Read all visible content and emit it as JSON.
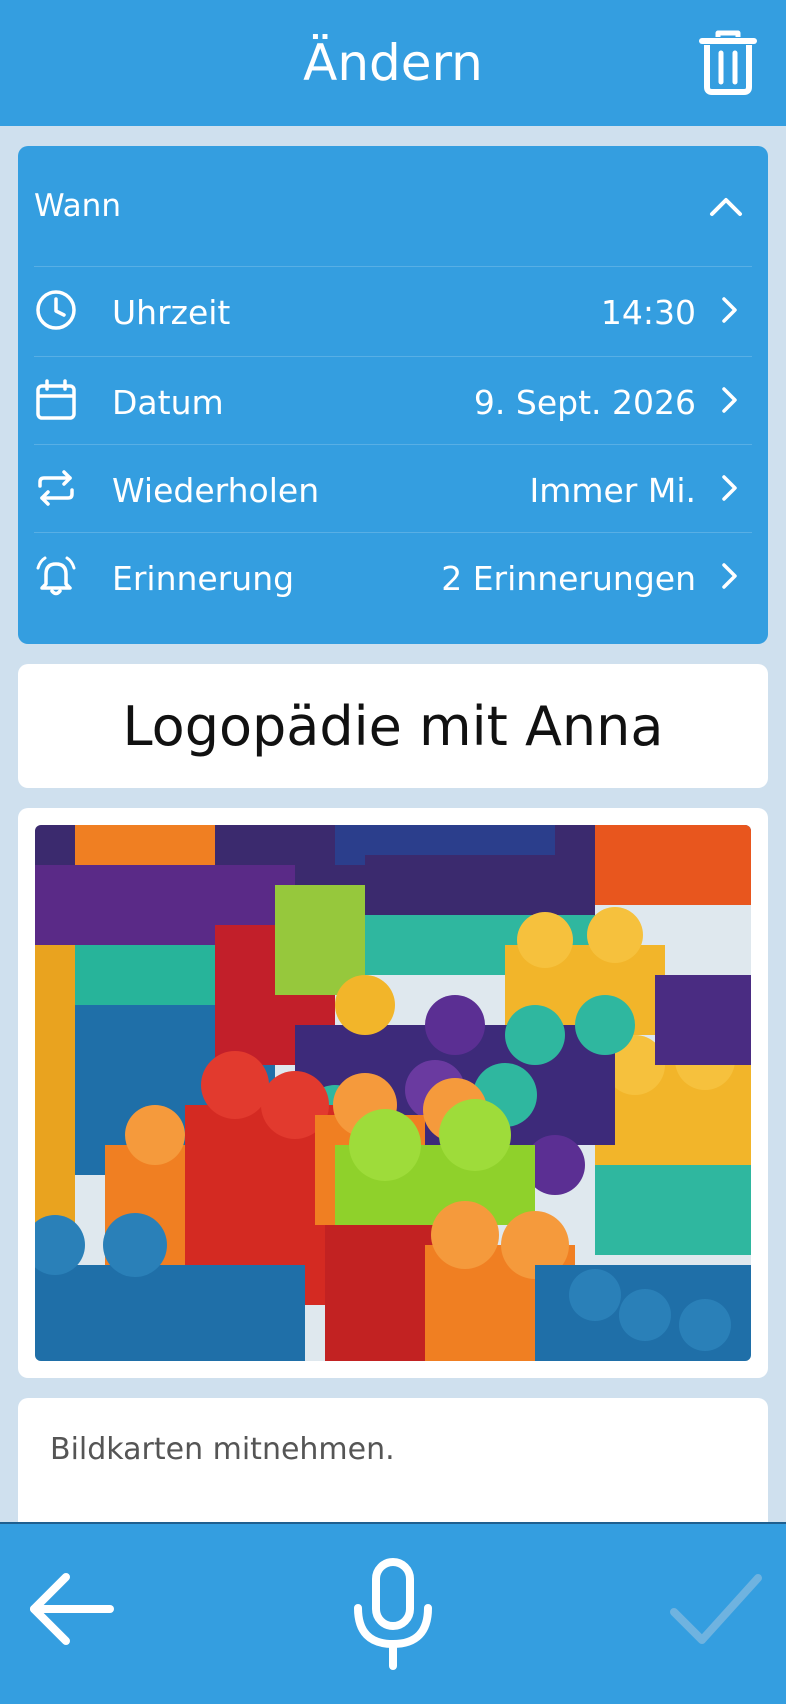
{
  "header": {
    "title": "Ändern",
    "delete_icon": "trash-icon"
  },
  "when": {
    "title": "Wann",
    "collapse_icon": "chevron-up-icon",
    "rows": [
      {
        "icon": "clock-icon",
        "label": "Uhrzeit",
        "value": "14:30"
      },
      {
        "icon": "calendar-icon",
        "label": "Datum",
        "value": "9. Sept. 2026"
      },
      {
        "icon": "repeat-icon",
        "label": "Wiederholen",
        "value": "Immer Mi."
      },
      {
        "icon": "bell-icon",
        "label": "Erinnerung",
        "value": "2 Erinnerungen"
      }
    ]
  },
  "event": {
    "title": "Logopädie mit Anna",
    "image": "colorful-building-blocks-photo"
  },
  "note": {
    "text": "Bildkarten mitnehmen."
  },
  "bottombar": {
    "back_icon": "arrow-left-icon",
    "mic_icon": "microphone-icon",
    "confirm_icon": "checkmark-icon"
  },
  "colors": {
    "primary": "#349ee0",
    "background": "#cfe0ee",
    "confirm_disabled": "#6fb3e0"
  }
}
